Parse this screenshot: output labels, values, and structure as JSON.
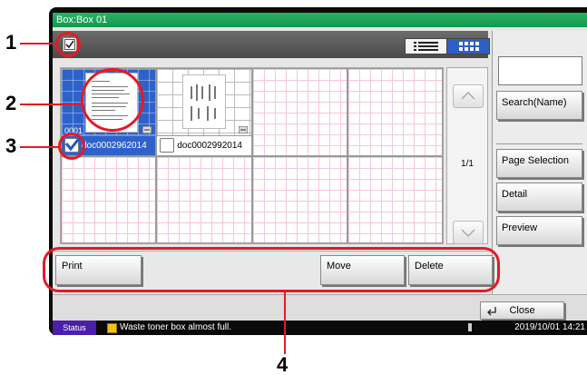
{
  "window": {
    "title": "Box:Box 01"
  },
  "grid": {
    "cells": [
      {
        "name": "doc0002962014",
        "number": "0001",
        "selected": true,
        "checked": true
      },
      {
        "name": "doc0002992014",
        "number": "",
        "selected": false,
        "checked": false
      }
    ]
  },
  "pager": {
    "indicator": "1/1"
  },
  "right_panel": {
    "search_button": "Search(Name)",
    "page_selection_button": "Page Selection",
    "detail_button": "Detail",
    "preview_button": "Preview"
  },
  "actions": {
    "print": "Print",
    "move": "Move",
    "delete": "Delete"
  },
  "close_button": "Close",
  "status": {
    "tag": "Status",
    "message": "Waste toner box almost full.",
    "datetime": "2019/10/01  14:21"
  },
  "callouts": [
    "1",
    "2",
    "3",
    "4"
  ],
  "colors": {
    "accent_green": "#12994d",
    "selection_blue": "#2f62c8",
    "callout_red": "#e31b23"
  }
}
